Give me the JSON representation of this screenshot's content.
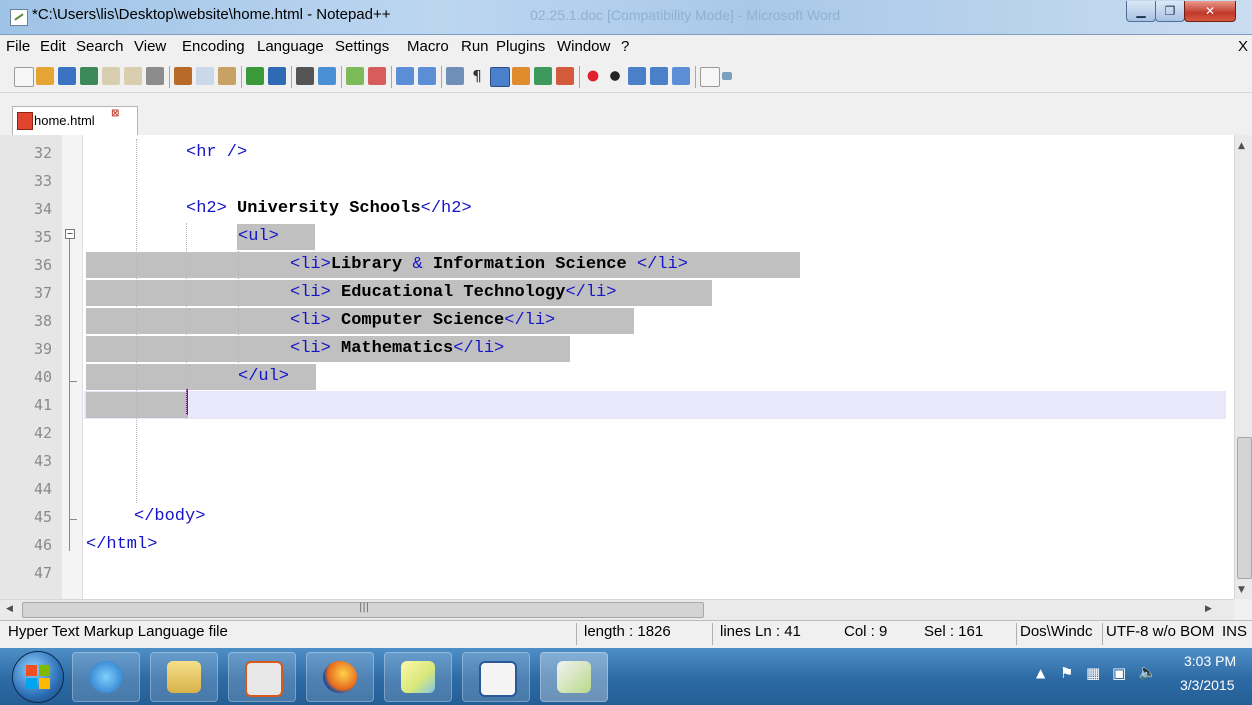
{
  "window": {
    "title": "*C:\\Users\\lis\\Desktop\\website\\home.html - Notepad++",
    "background_title": "02.25.1.doc [Compatibility Mode] - Microsoft Word"
  },
  "menu": {
    "items": [
      "File",
      "Edit",
      "Search",
      "View",
      "Encoding",
      "Language",
      "Settings",
      "Macro",
      "Run",
      "Plugins",
      "Window",
      "?"
    ],
    "close": "X"
  },
  "tab": {
    "label": "home.html"
  },
  "editor": {
    "lines": [
      {
        "num": "32",
        "tokens": [
          [
            "tag",
            "<hr />"
          ]
        ]
      },
      {
        "num": "33",
        "tokens": []
      },
      {
        "num": "34",
        "tokens": [
          [
            "tag",
            "<h2> "
          ],
          [
            "bold",
            "University Schools"
          ],
          [
            "tag",
            "</h2>"
          ]
        ]
      },
      {
        "num": "35",
        "tokens": [
          [
            "tag",
            "<ul>"
          ]
        ]
      },
      {
        "num": "36",
        "tokens": [
          [
            "tag",
            "<li>"
          ],
          [
            "bold",
            "Library "
          ],
          [
            "tag",
            "&"
          ],
          [
            "bold",
            " Information Science "
          ],
          [
            "tag",
            "</li>"
          ]
        ]
      },
      {
        "num": "37",
        "tokens": [
          [
            "tag",
            "<li> "
          ],
          [
            "bold",
            "Educational Technology"
          ],
          [
            "tag",
            "</li>"
          ]
        ]
      },
      {
        "num": "38",
        "tokens": [
          [
            "tag",
            "<li> "
          ],
          [
            "bold",
            "Computer Science"
          ],
          [
            "tag",
            "</li>"
          ]
        ]
      },
      {
        "num": "39",
        "tokens": [
          [
            "tag",
            "<li> "
          ],
          [
            "bold",
            "Mathematics"
          ],
          [
            "tag",
            "</li>"
          ]
        ]
      },
      {
        "num": "40",
        "tokens": [
          [
            "tag",
            "</ul>"
          ]
        ]
      },
      {
        "num": "41",
        "tokens": []
      },
      {
        "num": "42",
        "tokens": []
      },
      {
        "num": "43",
        "tokens": []
      },
      {
        "num": "44",
        "tokens": []
      },
      {
        "num": "45",
        "tokens": [
          [
            "tag",
            "</body>"
          ]
        ]
      },
      {
        "num": "46",
        "tokens": [
          [
            "tag",
            "</html>"
          ]
        ]
      },
      {
        "num": "47",
        "tokens": []
      }
    ],
    "current_line": "41"
  },
  "status": {
    "file_type": "Hyper Text Markup Language file",
    "length": "length : 1826",
    "lines": "lines Ln : 41",
    "col": "Col : 9",
    "sel": "Sel : 161",
    "eol": "Dos\\Windc",
    "encoding": "UTF-8 w/o BOM",
    "mode": "INS"
  },
  "taskbar": {
    "apps": [
      "internet-explorer",
      "file-explorer",
      "media-app",
      "firefox",
      "sticky-notes",
      "word",
      "notepad-plus-plus"
    ],
    "time": "3:03 PM",
    "date": "3/3/2015"
  },
  "colors": {
    "tag": "#1414c8",
    "selection": "#c0c0c0",
    "current_line": "#e9e8fb",
    "taskbar": "#2d6aa4"
  }
}
